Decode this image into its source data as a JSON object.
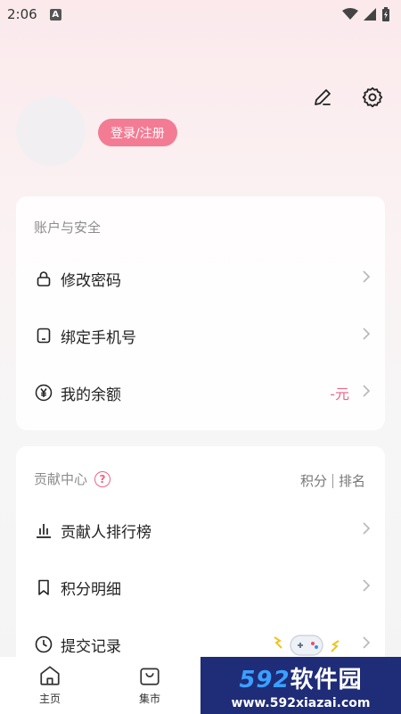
{
  "status_bar": {
    "time": "2:06",
    "notification_badge": "A"
  },
  "header": {
    "login_label": "登录/注册"
  },
  "account_section": {
    "title": "账户与安全",
    "items": [
      {
        "label": "修改密码",
        "icon": "lock-icon"
      },
      {
        "label": "绑定手机号",
        "icon": "phone-icon"
      },
      {
        "label": "我的余额",
        "icon": "yen-icon",
        "value": "-元"
      }
    ]
  },
  "contribution_section": {
    "title": "贡献中心",
    "help": "?",
    "tabs": [
      "积分",
      "排名"
    ],
    "items": [
      {
        "label": "贡献人排行榜",
        "icon": "bar-chart-icon"
      },
      {
        "label": "积分明细",
        "icon": "bookmark-icon"
      },
      {
        "label": "提交记录",
        "icon": "clock-icon"
      }
    ]
  },
  "bottom_nav": {
    "items": [
      {
        "label": "主页",
        "icon": "home-icon"
      },
      {
        "label": "集市",
        "icon": "shopping-bag-icon"
      }
    ]
  },
  "watermark": {
    "number": "592",
    "brand": "软件园",
    "url": "www.592xiazai.com"
  },
  "colors": {
    "accent": "#f37c94",
    "accent_text": "#ee6485",
    "watermark_bg": "#1f2c77"
  }
}
